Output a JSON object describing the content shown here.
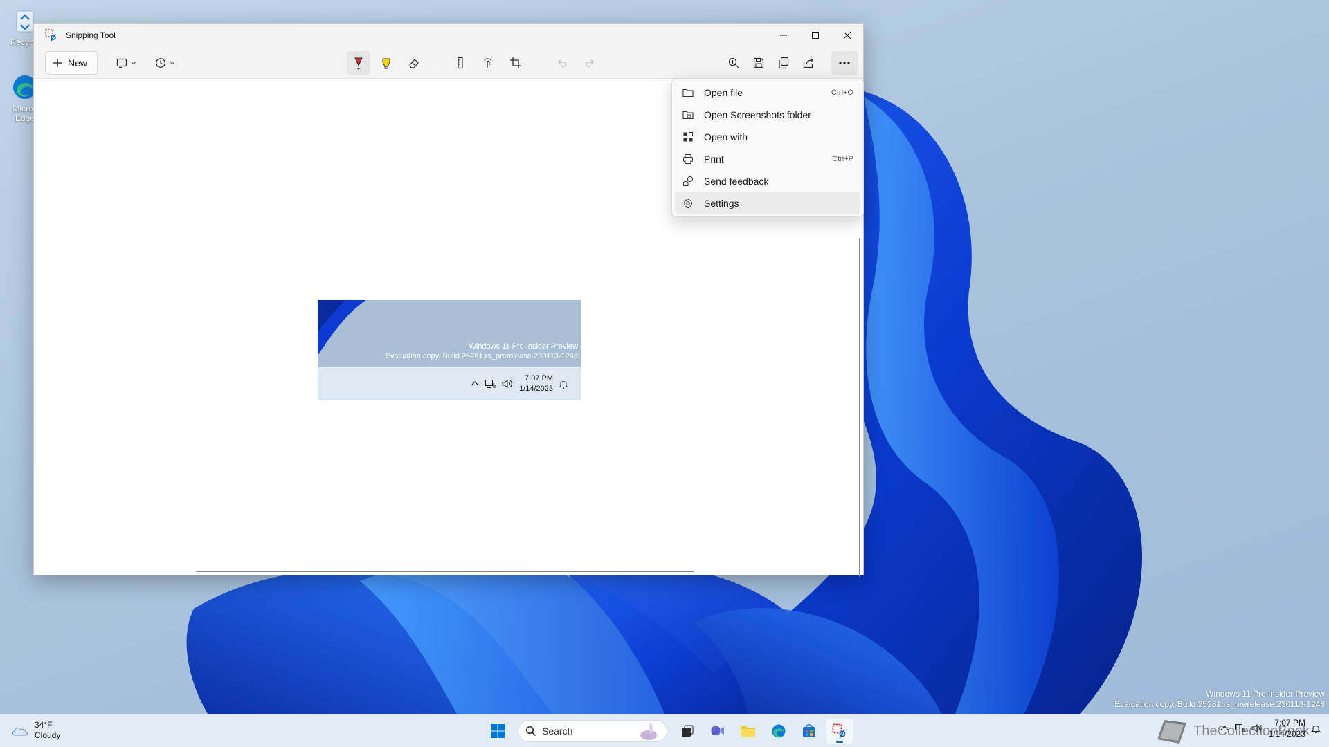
{
  "desktop": {
    "icons": [
      {
        "label": "Recycle"
      },
      {
        "label": "Micros Edge"
      }
    ],
    "watermark_line1": "Windows 11 Pro Insider Preview",
    "watermark_line2": "Evaluation copy. Build 25281.rs_prerelease.230113-1248"
  },
  "window": {
    "title": "Snipping Tool",
    "toolbar": {
      "new_label": "New"
    }
  },
  "screenshot": {
    "watermark_line1": "Windows 11 Pro Insider Preview",
    "watermark_line2": "Evaluation copy. Build 25281.rs_prerelease.230113-1248",
    "time": "7:07 PM",
    "date": "1/14/2023"
  },
  "menu": {
    "items": [
      {
        "label": "Open file",
        "shortcut": "Ctrl+O",
        "icon": "folder-icon"
      },
      {
        "label": "Open Screenshots folder",
        "shortcut": "",
        "icon": "screenshots-folder-icon"
      },
      {
        "label": "Open with",
        "shortcut": "",
        "icon": "open-with-icon"
      },
      {
        "label": "Print",
        "shortcut": "Ctrl+P",
        "icon": "printer-icon"
      },
      {
        "label": "Send feedback",
        "shortcut": "",
        "icon": "feedback-icon"
      },
      {
        "label": "Settings",
        "shortcut": "",
        "icon": "gear-icon"
      }
    ]
  },
  "taskbar": {
    "weather_temp": "34°F",
    "weather_desc": "Cloudy",
    "search_placeholder": "Search",
    "time": "7:07 PM",
    "date": "1/14/2023",
    "brand": "TheCollectionBook"
  },
  "colors": {
    "accent": "#0067c0",
    "pen_red": "#d13438",
    "highlighter_yellow": "#f7d400"
  }
}
